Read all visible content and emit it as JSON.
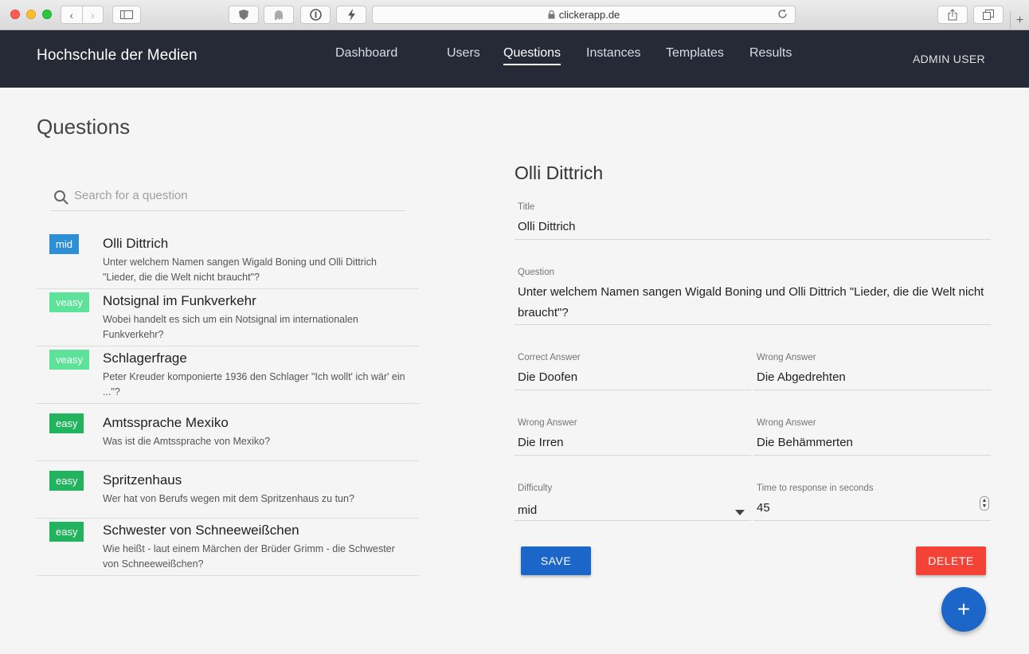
{
  "browser": {
    "url": "clickerapp.de",
    "back_icon": "‹",
    "forward_icon": "›"
  },
  "app": {
    "brand": "Hochschule der Medien",
    "nav": [
      "Dashboard",
      "Users",
      "Questions",
      "Instances",
      "Templates",
      "Results"
    ],
    "active_nav": "Questions",
    "user": "ADMIN USER"
  },
  "page": {
    "title": "Questions"
  },
  "search": {
    "placeholder": "Search for a question",
    "value": ""
  },
  "questions": [
    {
      "difficulty": "mid",
      "title": "Olli Dittrich",
      "text": "Unter welchem Namen sangen Wigald Boning und Olli Dittrich \"Lieder, die die Welt nicht braucht\"?"
    },
    {
      "difficulty": "veasy",
      "title": "Notsignal im Funkverkehr",
      "text": "Wobei handelt es sich um ein Notsignal im internationalen Funkverkehr?"
    },
    {
      "difficulty": "veasy",
      "title": "Schlagerfrage",
      "text": "Peter Kreuder komponierte 1936 den Schlager \"Ich wollt' ich wär' ein ...\"?"
    },
    {
      "difficulty": "easy",
      "title": "Amtssprache Mexiko",
      "text": "Was ist die Amtssprache von Mexiko?"
    },
    {
      "difficulty": "easy",
      "title": "Spritzenhaus",
      "text": "Wer hat von Berufs wegen mit dem Spritzenhaus zu tun?"
    },
    {
      "difficulty": "easy",
      "title": "Schwester von Schneeweißchen",
      "text": "Wie heißt - laut einem Märchen der Brüder Grimm - die Schwester von Schneeweißchen?"
    }
  ],
  "editor": {
    "heading": "Olli Dittrich",
    "title_label": "Title",
    "title_value": "Olli Dittrich",
    "question_label": "Question",
    "question_value": "Unter welchem Namen sangen Wigald Boning und Olli Dittrich \"Lieder, die die Welt nicht braucht\"?",
    "correct_label": "Correct Answer",
    "correct_value": "Die Doofen",
    "wrong1_label": "Wrong Answer",
    "wrong1_value": "Die Abgedrehten",
    "wrong2_label": "Wrong Answer",
    "wrong2_value": "Die Irren",
    "wrong3_label": "Wrong Answer",
    "wrong3_value": "Die Behämmerten",
    "difficulty_label": "Difficulty",
    "difficulty_value": "mid",
    "time_label": "Time to response in seconds",
    "time_value": "45",
    "save_label": "SAVE",
    "delete_label": "DELETE",
    "fab_label": "+"
  },
  "colors": {
    "mid": "#2d8fd5",
    "veasy": "#5de29a",
    "easy": "#21b35e",
    "primary": "#1c66c9",
    "danger": "#f44336",
    "appbar": "#262a36"
  }
}
